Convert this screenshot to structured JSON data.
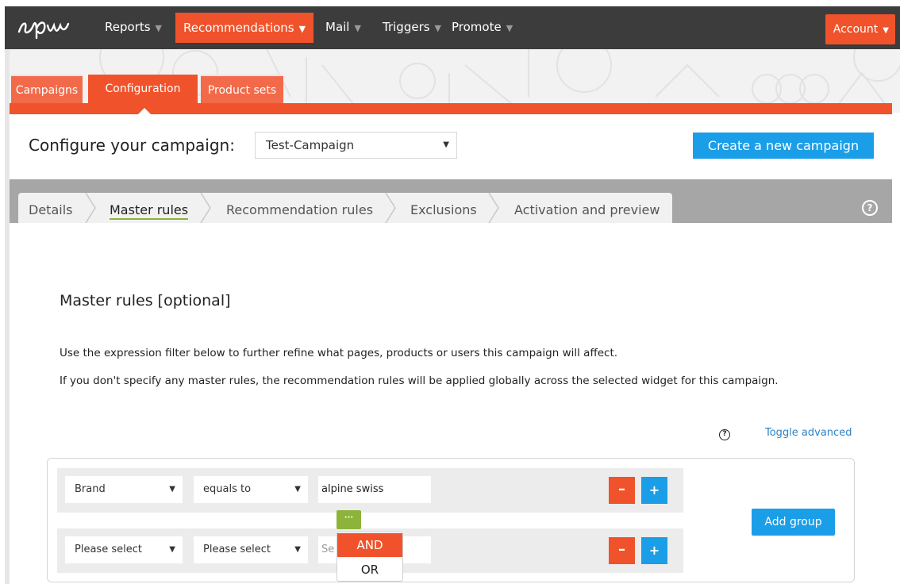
{
  "nav": {
    "items": [
      {
        "label": "Reports",
        "active": false
      },
      {
        "label": "Recommendations",
        "active": true
      },
      {
        "label": "Mail",
        "active": false
      },
      {
        "label": "Triggers",
        "active": false
      },
      {
        "label": "Promote",
        "active": false
      }
    ],
    "account_label": "Account",
    "logo_icon": "episerver-logo"
  },
  "page_tabs": {
    "campaigns": "Campaigns",
    "configuration": "Configuration",
    "product_sets": "Product sets",
    "active": "Configuration"
  },
  "configure": {
    "label": "Configure your campaign:",
    "selected_campaign": "Test-Campaign",
    "create_button": "Create a new campaign"
  },
  "steps": {
    "items": [
      "Details",
      "Master rules",
      "Recommendation rules",
      "Exclusions",
      "Activation and preview"
    ],
    "active": "Master rules",
    "help_icon": "help-circle-icon"
  },
  "master_rules": {
    "title": "Master rules [optional]",
    "description_1": "Use the expression filter below to further refine what pages, products or users this campaign will affect.",
    "description_2": "If you don't specify any master rules, the recommendation rules will be applied globally across the selected widget for this campaign.",
    "toggle_advanced": "Toggle advanced",
    "rows": [
      {
        "field": "Brand",
        "operator": "equals to",
        "value": "alpine swiss",
        "value_placeholder": ""
      },
      {
        "field": "Please select",
        "operator": "Please select",
        "value": "",
        "value_placeholder": "Se"
      }
    ],
    "minus_label": "–",
    "plus_label": "+",
    "add_group": "Add group",
    "conjunction_button": "···",
    "conjunction_options": [
      "AND",
      "OR"
    ],
    "conjunction_selected": "AND"
  },
  "colors": {
    "brand_orange": "#f0532b",
    "action_blue": "#1a9ee8",
    "accent_green": "#8db33b",
    "nav_dark": "#3c3c3c"
  }
}
